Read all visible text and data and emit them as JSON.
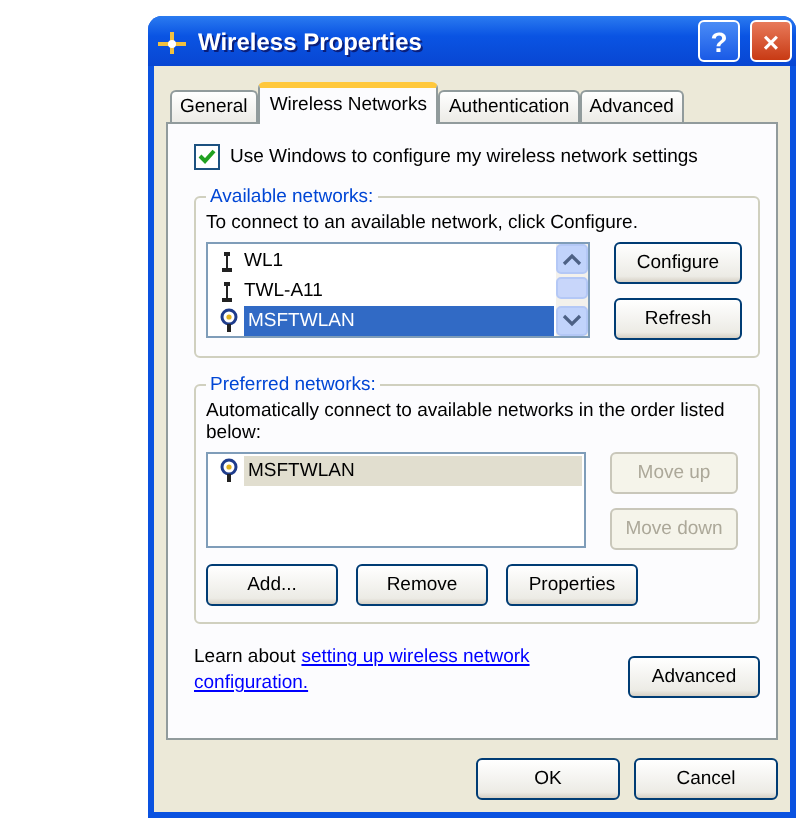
{
  "window": {
    "title": "Wireless Properties",
    "help": "?",
    "close": "×"
  },
  "tabs": [
    {
      "label": "General",
      "selected": false
    },
    {
      "label": "Wireless Networks",
      "selected": true
    },
    {
      "label": "Authentication",
      "selected": false
    },
    {
      "label": "Advanced",
      "selected": false
    }
  ],
  "use_windows": {
    "label": "Use Windows to configure my wireless network settings",
    "checked": true
  },
  "available": {
    "title": "Available networks:",
    "hint": "To connect to an available network, click Configure.",
    "focused": true,
    "items": [
      {
        "name": "WL1",
        "kind": "antenna",
        "selected": false
      },
      {
        "name": "TWL-A11",
        "kind": "antenna",
        "selected": false
      },
      {
        "name": "MSFTWLAN",
        "kind": "access-point",
        "selected": true
      }
    ],
    "buttons": [
      {
        "label": "Configure",
        "disabled": false
      },
      {
        "label": "Refresh",
        "disabled": false
      }
    ]
  },
  "preferred": {
    "title": "Preferred networks:",
    "hint": "Automatically connect to available networks in the order listed below:",
    "focused": false,
    "items": [
      {
        "name": "MSFTWLAN",
        "kind": "access-point",
        "selected": true
      }
    ],
    "side_buttons": [
      {
        "label": "Move up",
        "disabled": true
      },
      {
        "label": "Move down",
        "disabled": true
      }
    ],
    "buttons": [
      {
        "label": "Add...",
        "disabled": false
      },
      {
        "label": "Remove",
        "disabled": false
      },
      {
        "label": "Properties",
        "disabled": false
      }
    ]
  },
  "learn": {
    "prefix": "Learn about",
    "link_lines": [
      "setting up wireless network",
      "configuration."
    ]
  },
  "advanced_button": {
    "label": "Advanced",
    "disabled": false
  },
  "footer_buttons": [
    {
      "label": "OK",
      "disabled": false
    },
    {
      "label": "Cancel",
      "disabled": false
    }
  ]
}
